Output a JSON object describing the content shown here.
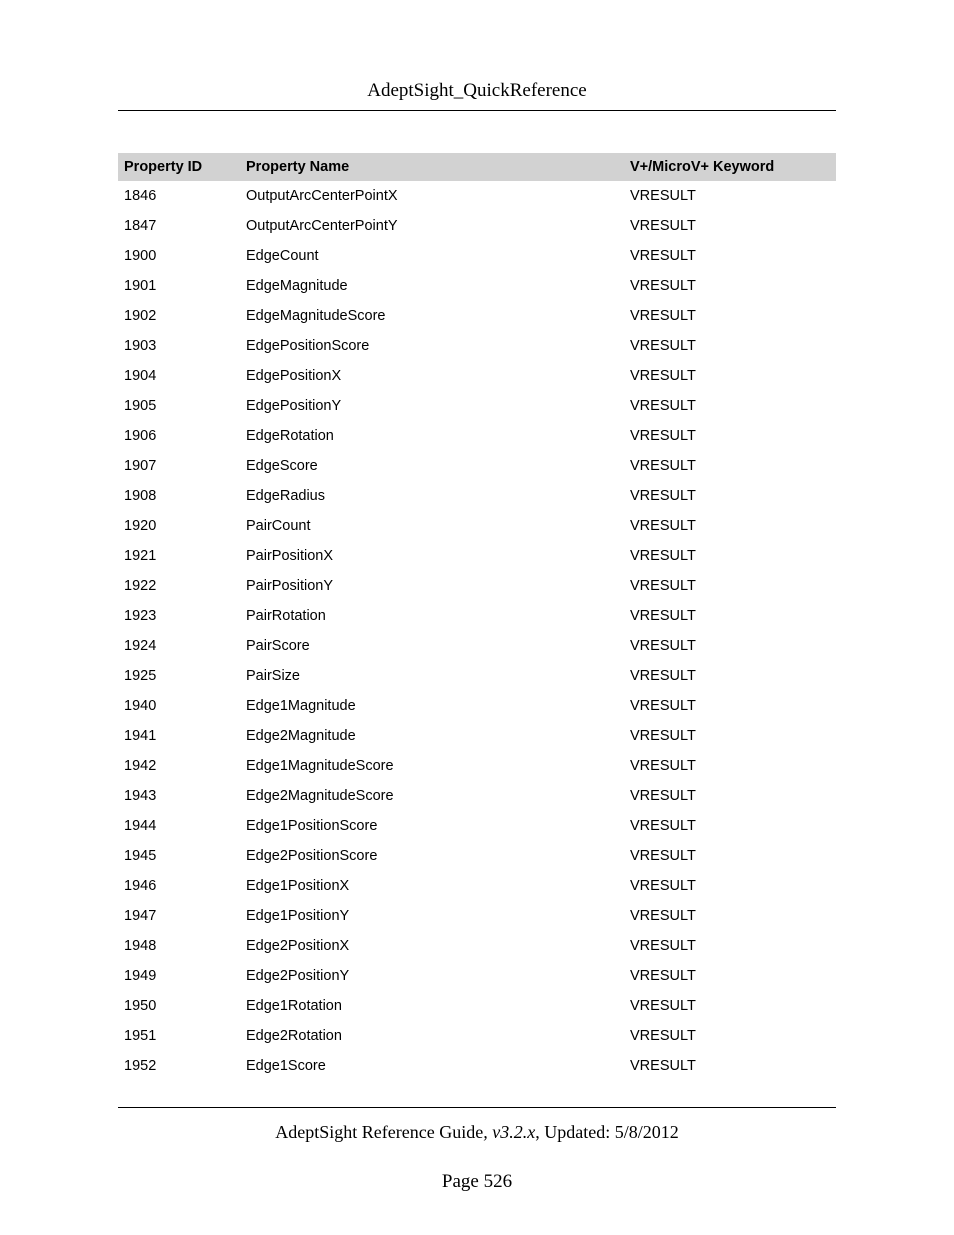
{
  "header": {
    "title": "AdeptSight_QuickReference"
  },
  "table": {
    "headers": {
      "id": "Property ID",
      "name": "Property Name",
      "keyword": "V+/MicroV+ Keyword"
    },
    "rows": [
      {
        "id": "1846",
        "name": "OutputArcCenterPointX",
        "keyword": "VRESULT"
      },
      {
        "id": "1847",
        "name": "OutputArcCenterPointY",
        "keyword": "VRESULT"
      },
      {
        "id": "1900",
        "name": "EdgeCount",
        "keyword": "VRESULT"
      },
      {
        "id": "1901",
        "name": "EdgeMagnitude",
        "keyword": "VRESULT"
      },
      {
        "id": "1902",
        "name": "EdgeMagnitudeScore",
        "keyword": "VRESULT"
      },
      {
        "id": "1903",
        "name": "EdgePositionScore",
        "keyword": "VRESULT"
      },
      {
        "id": "1904",
        "name": "EdgePositionX",
        "keyword": "VRESULT"
      },
      {
        "id": "1905",
        "name": "EdgePositionY",
        "keyword": "VRESULT"
      },
      {
        "id": "1906",
        "name": "EdgeRotation",
        "keyword": "VRESULT"
      },
      {
        "id": "1907",
        "name": "EdgeScore",
        "keyword": "VRESULT"
      },
      {
        "id": "1908",
        "name": "EdgeRadius",
        "keyword": "VRESULT"
      },
      {
        "id": "1920",
        "name": "PairCount",
        "keyword": "VRESULT"
      },
      {
        "id": "1921",
        "name": "PairPositionX",
        "keyword": "VRESULT"
      },
      {
        "id": "1922",
        "name": "PairPositionY",
        "keyword": "VRESULT"
      },
      {
        "id": "1923",
        "name": "PairRotation",
        "keyword": "VRESULT"
      },
      {
        "id": "1924",
        "name": "PairScore",
        "keyword": "VRESULT"
      },
      {
        "id": "1925",
        "name": "PairSize",
        "keyword": "VRESULT"
      },
      {
        "id": "1940",
        "name": "Edge1Magnitude",
        "keyword": "VRESULT"
      },
      {
        "id": "1941",
        "name": "Edge2Magnitude",
        "keyword": "VRESULT"
      },
      {
        "id": "1942",
        "name": "Edge1MagnitudeScore",
        "keyword": "VRESULT"
      },
      {
        "id": "1943",
        "name": "Edge2MagnitudeScore",
        "keyword": "VRESULT"
      },
      {
        "id": "1944",
        "name": "Edge1PositionScore",
        "keyword": "VRESULT"
      },
      {
        "id": "1945",
        "name": "Edge2PositionScore",
        "keyword": "VRESULT"
      },
      {
        "id": "1946",
        "name": "Edge1PositionX",
        "keyword": "VRESULT"
      },
      {
        "id": "1947",
        "name": "Edge1PositionY",
        "keyword": "VRESULT"
      },
      {
        "id": "1948",
        "name": "Edge2PositionX",
        "keyword": "VRESULT"
      },
      {
        "id": "1949",
        "name": "Edge2PositionY",
        "keyword": "VRESULT"
      },
      {
        "id": "1950",
        "name": "Edge1Rotation",
        "keyword": "VRESULT"
      },
      {
        "id": "1951",
        "name": "Edge2Rotation",
        "keyword": "VRESULT"
      },
      {
        "id": "1952",
        "name": "Edge1Score",
        "keyword": "VRESULT"
      }
    ]
  },
  "footer": {
    "guide_name": "AdeptSight Reference Guide",
    "version_italic": ", v3.2.x",
    "updated": ", Updated: 5/8/2012",
    "page_label": "Page 526"
  }
}
